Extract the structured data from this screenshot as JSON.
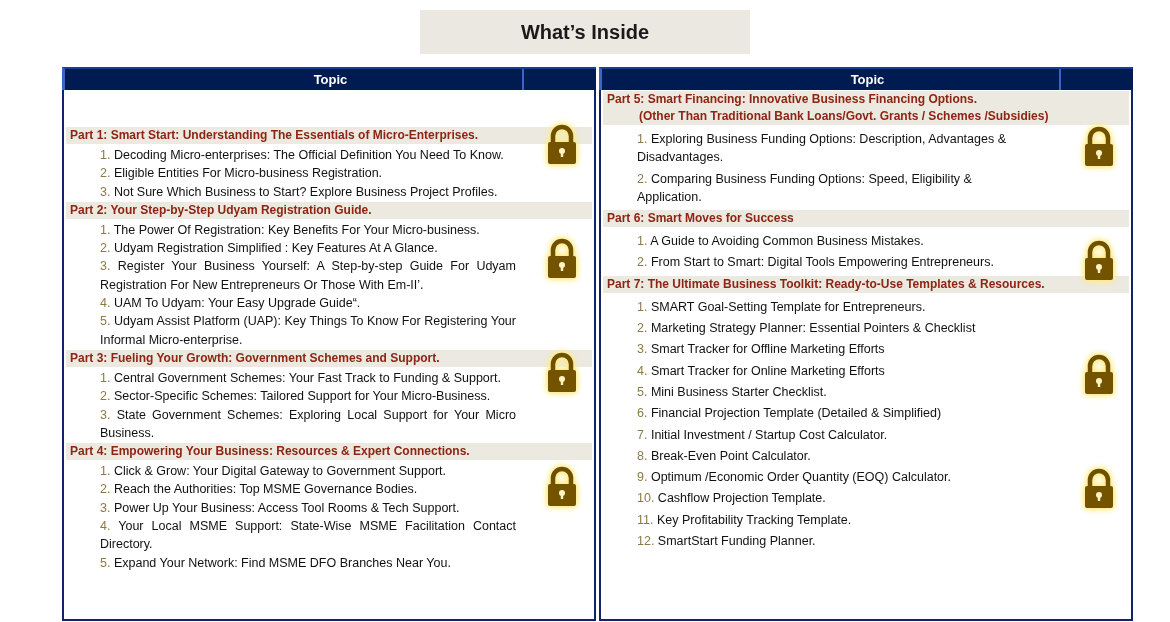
{
  "title": "What’s Inside",
  "columns": [
    {
      "heading": "Topic",
      "parts": [
        {
          "title": "Part 1: Smart Start: Understanding The Essentials of Micro-Enterprises.",
          "items": [
            {
              "number": "1.",
              "text": "Decoding Micro-enterprises: The Official Definition You Need To Know."
            },
            {
              "number": "2.",
              "text": "Eligible Entities For Micro-business Registration."
            },
            {
              "number": "3.",
              "text": "Not Sure Which Business to Start? Explore Business Project Profiles."
            }
          ]
        },
        {
          "title": "Part 2: Your Step-by-Step  Udyam Registration Guide.",
          "items": [
            {
              "number": "1.",
              "text": "The Power Of Registration: Key Benefits For Your Micro-business."
            },
            {
              "number": "2.",
              "text": "Udyam Registration Simplified : Key Features At A Glance."
            },
            {
              "number": "3.",
              "text": "Register Your Business Yourself: A Step-by-step Guide For Udyam Registration For New Entrepreneurs Or Those With Em-II’."
            },
            {
              "number": "4.",
              "text": "UAM To Udyam: Your Easy Upgrade Guide“."
            },
            {
              "number": "5.",
              "text": "Udyam Assist Platform (UAP): Key Things To Know For Registering Your Informal Micro-enterprise."
            }
          ]
        },
        {
          "title": "Part 3: Fueling Your Growth: Government Schemes and Support.",
          "items": [
            {
              "number": "1.",
              "text": "Central Government Schemes: Your Fast Track to Funding & Support."
            },
            {
              "number": "2.",
              "text": "Sector-Specific Schemes: Tailored Support for Your Micro-Business."
            },
            {
              "number": "3.",
              "text": "State Government Schemes: Exploring Local Support for Your Micro Business."
            }
          ]
        },
        {
          "title": "Part 4: Empowering Your Business: Resources & Expert Connections.",
          "items": [
            {
              "number": "1.",
              "text": "Click & Grow: Your Digital Gateway to Government Support."
            },
            {
              "number": "2.",
              "text": "Reach the Authorities: Top MSME Governance Bodies."
            },
            {
              "number": "3.",
              "text": "Power Up Your Business: Access Tool Rooms & Tech Support."
            },
            {
              "number": "4.",
              "text": "Your Local MSME Support: State-Wise MSME Facilitation Contact Directory."
            },
            {
              "number": "5.",
              "text": "Expand Your Network: Find MSME DFO Branches Near You."
            }
          ]
        }
      ]
    },
    {
      "heading": "Topic",
      "parts": [
        {
          "title": "Part 5: Smart Financing: Innovative Business Financing Options.",
          "subtitle": "(Other Than Traditional Bank Loans/Govt. Grants / Schemes /Subsidies)",
          "items": [
            {
              "number": "1.",
              "text": "Exploring Business Funding Options: Description, Advantages & Disadvantages."
            },
            {
              "number": "2.",
              "text": "Comparing Business Funding Options: Speed, Eligibility & Application."
            }
          ]
        },
        {
          "title": "Part 6: Smart Moves for Success",
          "items": [
            {
              "number": "1.",
              "text": "A Guide to Avoiding Common Business Mistakes."
            },
            {
              "number": "2.",
              "text": "From Start to Smart: Digital Tools Empowering Entrepreneurs."
            }
          ]
        },
        {
          "title": "Part 7: The Ultimate Business Toolkit: Ready-to-Use Templates & Resources.",
          "items": [
            {
              "number": "1.",
              "text": "SMART Goal-Setting Template for Entrepreneurs."
            },
            {
              "number": "2.",
              "text": "Marketing Strategy Planner: Essential Pointers & Checklist"
            },
            {
              "number": "3.",
              "text": "Smart Tracker for Offline Marketing Efforts"
            },
            {
              "number": "4.",
              "text": "Smart Tracker for Online Marketing Efforts"
            },
            {
              "number": "5.",
              "text": "Mini Business Starter Checklist."
            },
            {
              "number": "6.",
              "text": "Financial Projection Template (Detailed & Simplified)"
            },
            {
              "number": "7.",
              "text": "Initial Investment / Startup Cost Calculator."
            },
            {
              "number": "8.",
              "text": "Break-Even Point Calculator."
            },
            {
              "number": "9.",
              "text": "Optimum /Economic Order Quantity (EOQ) Calculator."
            },
            {
              "number": "10.",
              "text": "Cashflow Projection Template."
            },
            {
              "number": "11.",
              "text": "Key Profitability Tracking Template."
            },
            {
              "number": "12.",
              "text": "SmartStart Funding Planner."
            }
          ]
        }
      ]
    }
  ]
}
